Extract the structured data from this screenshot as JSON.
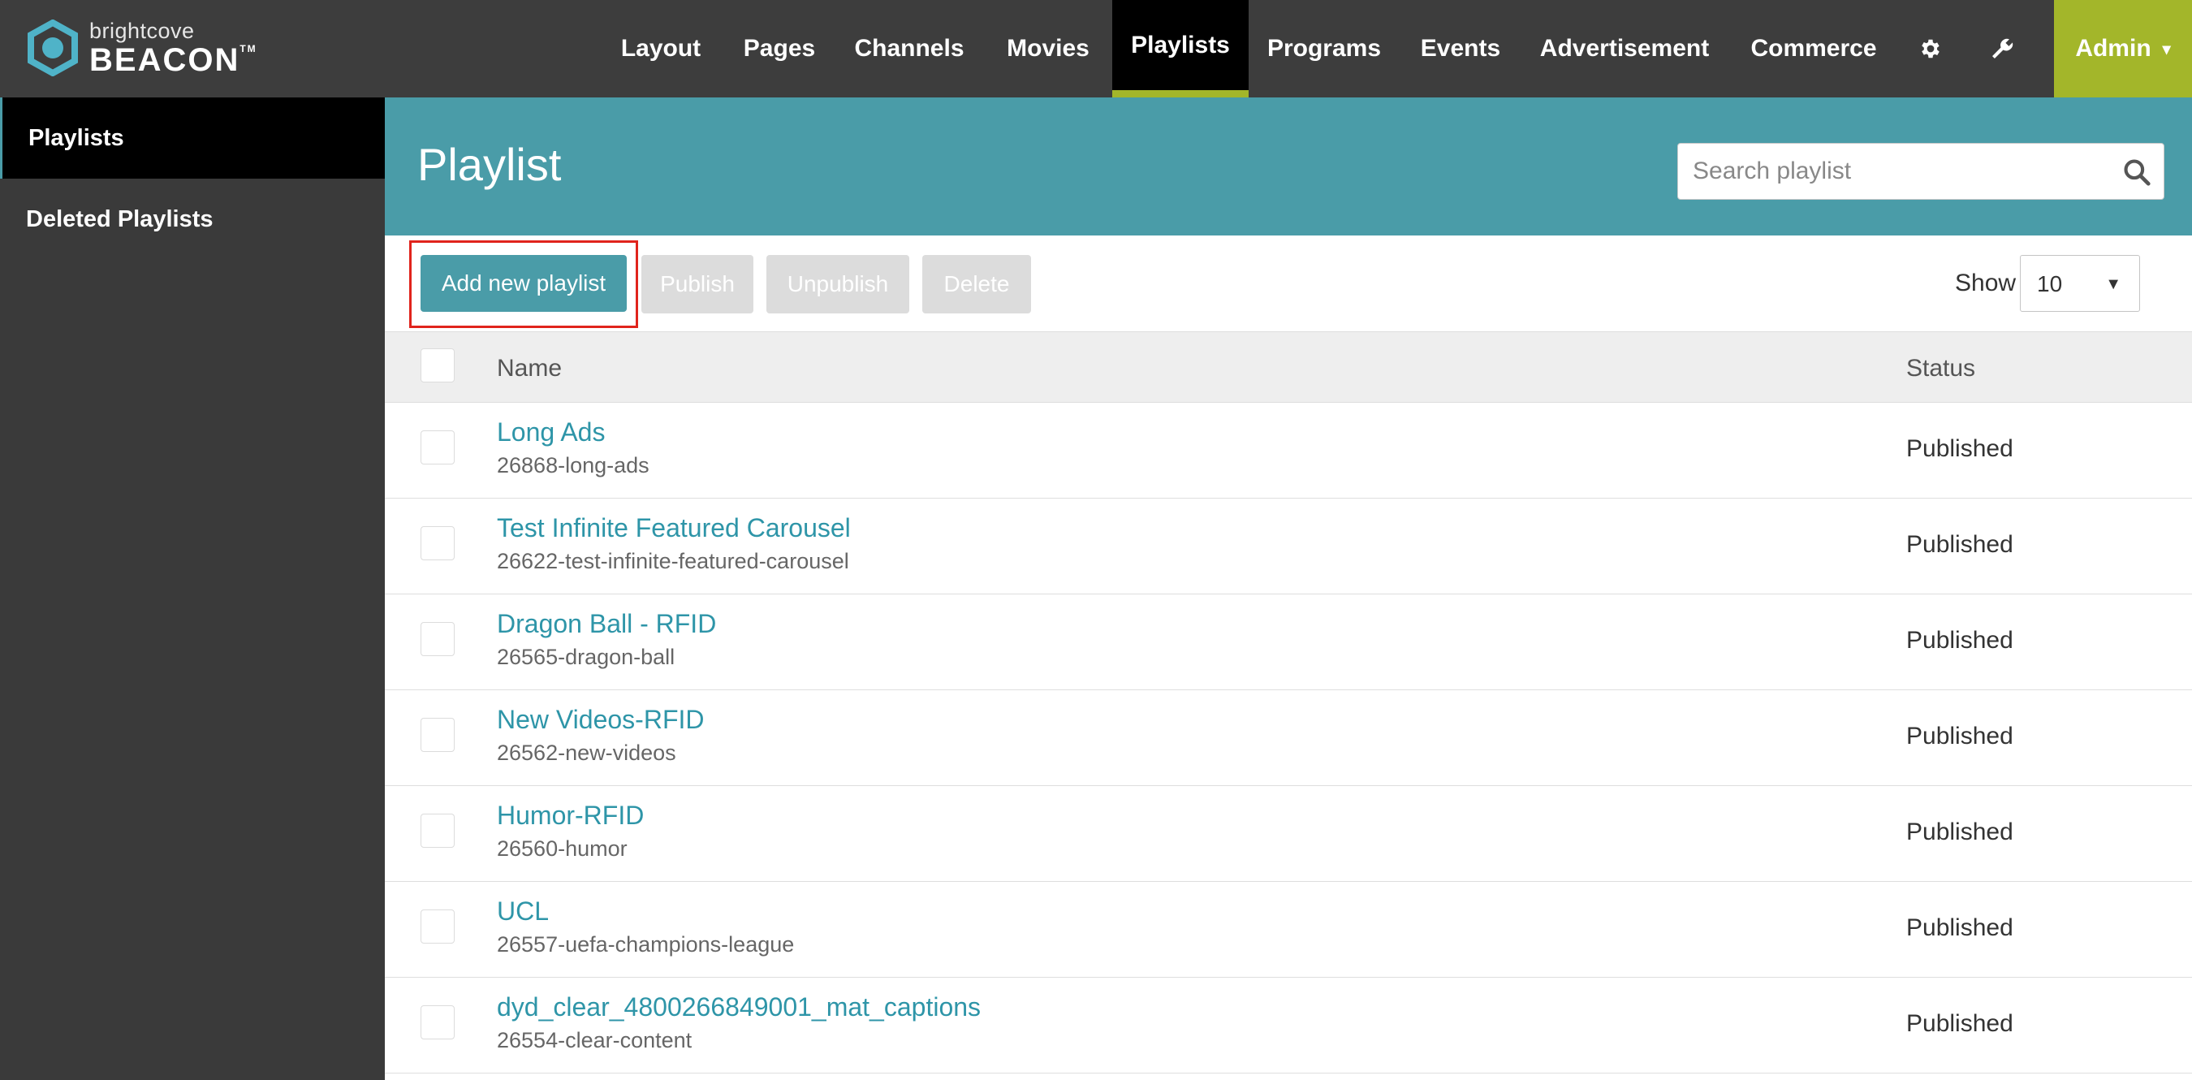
{
  "logo": {
    "small": "brightcove",
    "big": "BEACON",
    "tm": "TM"
  },
  "nav": {
    "items": [
      {
        "label": "Layout"
      },
      {
        "label": "Pages"
      },
      {
        "label": "Channels"
      },
      {
        "label": "Movies"
      },
      {
        "label": "Playlists",
        "active": true
      },
      {
        "label": "Programs"
      },
      {
        "label": "Events"
      },
      {
        "label": "Advertisement"
      },
      {
        "label": "Commerce"
      }
    ],
    "icons": [
      "gear-icon",
      "wrench-icon"
    ],
    "admin_label": "Admin"
  },
  "sidebar": {
    "items": [
      {
        "label": "Playlists",
        "active": true
      },
      {
        "label": "Deleted Playlists"
      }
    ]
  },
  "header": {
    "title": "Playlist",
    "search_placeholder": "Search playlist"
  },
  "toolbar": {
    "add_label": "Add new playlist",
    "publish_label": "Publish",
    "unpublish_label": "Unpublish",
    "delete_label": "Delete",
    "show_label": "Show",
    "show_value": "10"
  },
  "table": {
    "columns": {
      "name": "Name",
      "status": "Status"
    },
    "rows": [
      {
        "name": "Long Ads",
        "slug": "26868-long-ads",
        "status": "Published"
      },
      {
        "name": "Test Infinite Featured Carousel",
        "slug": "26622-test-infinite-featured-carousel",
        "status": "Published"
      },
      {
        "name": "Dragon Ball - RFID",
        "slug": "26565-dragon-ball",
        "status": "Published"
      },
      {
        "name": "New Videos-RFID",
        "slug": "26562-new-videos",
        "status": "Published"
      },
      {
        "name": "Humor-RFID",
        "slug": "26560-humor",
        "status": "Published"
      },
      {
        "name": "UCL",
        "slug": "26557-uefa-champions-league",
        "status": "Published"
      },
      {
        "name": "dyd_clear_4800266849001_mat_captions",
        "slug": "26554-clear-content",
        "status": "Published"
      }
    ]
  },
  "colors": {
    "topbar": "#3d3d3d",
    "accent_green": "#a3b62a",
    "teal": "#4a9ca8",
    "link": "#2e95a8",
    "highlight_red": "#e0241c"
  }
}
